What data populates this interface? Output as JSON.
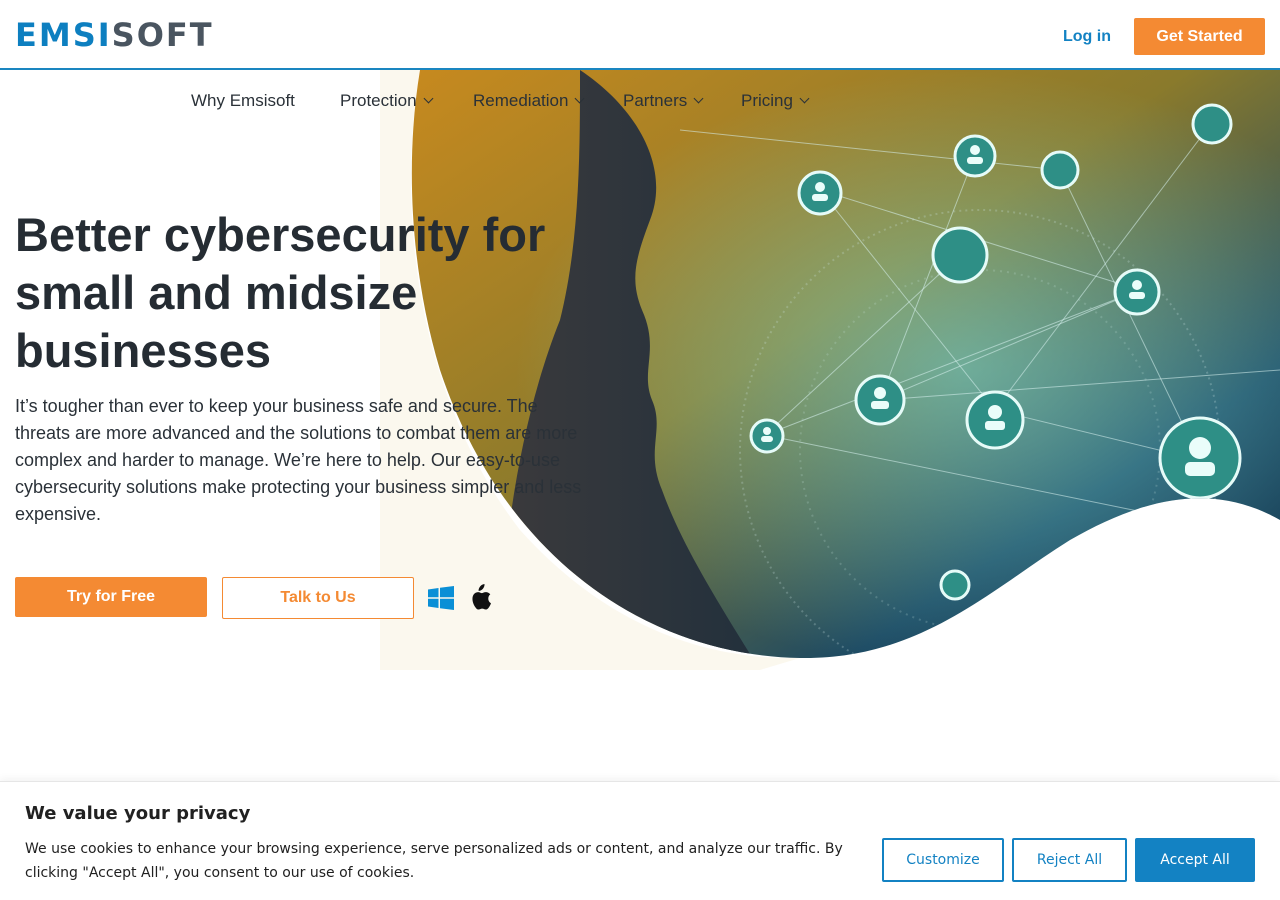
{
  "header": {
    "logo_part1": "EMSI",
    "logo_part2": "SOFT",
    "login_label": "Log in",
    "get_started_label": "Get Started"
  },
  "nav": {
    "items": [
      {
        "label": "Why Emsisoft",
        "dropdown": false
      },
      {
        "label": "Protection",
        "dropdown": true
      },
      {
        "label": "Remediation",
        "dropdown": true
      },
      {
        "label": "Partners",
        "dropdown": true
      },
      {
        "label": "Pricing",
        "dropdown": true
      }
    ]
  },
  "hero": {
    "title": "Better cybersecurity for small and midsize businesses",
    "copy": "It’s tougher than ever to keep your business safe and secure. The threats are more advanced and the solutions to combat them are more complex and harder to manage. We’re here to help. Our easy-to-use cybersecurity solutions make protecting your business simpler and less expensive.",
    "try_label": "Try for Free",
    "talk_label": "Talk to Us",
    "os_icons": [
      "windows-icon",
      "apple-icon"
    ]
  },
  "cookie": {
    "title": "We value your privacy",
    "text": "We use cookies to enhance your browsing experience, serve personalized ads or content, and analyze our traffic. By clicking \"Accept All\", you consent to our use of cookies.",
    "customize_label": "Customize",
    "reject_label": "Reject All",
    "accept_label": "Accept All"
  },
  "colors": {
    "brand_blue": "#1382c3",
    "accent_orange": "#f48a33",
    "text_dark": "#252c33"
  }
}
